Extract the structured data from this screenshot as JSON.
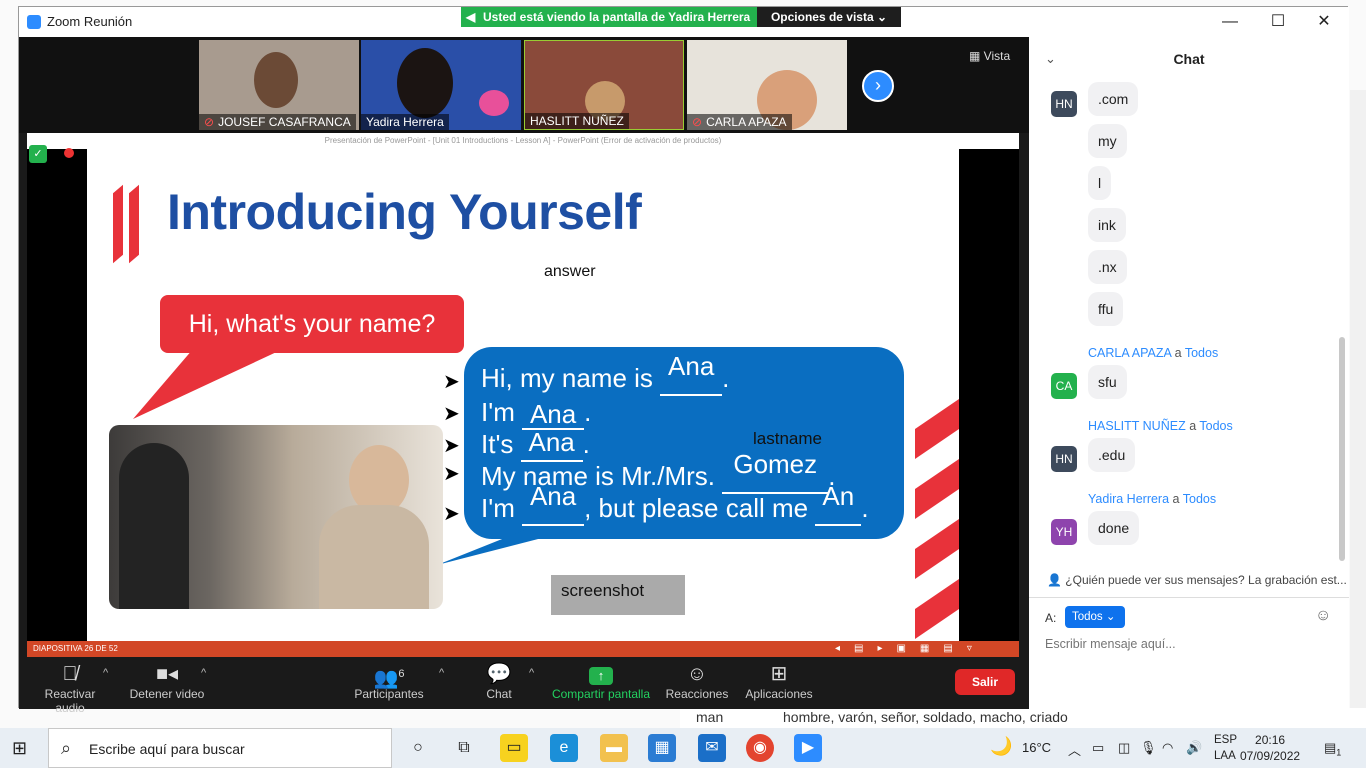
{
  "window": {
    "title": "Zoom Reunión",
    "share_banner": "Usted está viendo la pantalla de Yadira Herrera",
    "view_options": "Opciones de vista",
    "view_btn": "Vista"
  },
  "participants": [
    {
      "name": "JOUSEF CASAFRANCA",
      "muted": true,
      "color": "#a89b8f"
    },
    {
      "name": "Yadira Herrera",
      "muted": false,
      "color": "#2a4fa8"
    },
    {
      "name": "HASLITT NUÑEZ",
      "muted": false,
      "color": "#8a4a3a"
    },
    {
      "name": "CARLA APAZA",
      "muted": true,
      "color": "#e7e3db"
    }
  ],
  "ppt": {
    "window_title": "Presentación de PowerPoint - [Unit 01 Introductions - Lesson A] - PowerPoint (Error de activación de productos)",
    "status": "DIAPOSITIVA 26 DE 52"
  },
  "slide": {
    "title": "Introducing Yourself",
    "answer_label": "answer",
    "question": "Hi, what's your name?",
    "lines": [
      {
        "pre": "Hi, my name is ",
        "fill": "Ana",
        "post": "."
      },
      {
        "pre": "I'm ",
        "fill": "Ana",
        "post": "."
      },
      {
        "pre": "It's ",
        "fill": "Ana",
        "post": "."
      },
      {
        "pre": "My name is Mr./Mrs. ",
        "fill": "Gomez",
        "post": "."
      },
      {
        "pre": "I'm ",
        "fill": "Ana",
        "mid": ", but please call me ",
        "fill2": "An",
        "post": "."
      }
    ],
    "lastname_label": "lastname",
    "screenshot_label": "screenshot"
  },
  "toolbar": {
    "audio": "Reactivar audio",
    "video": "Detener video",
    "participants": "Participantes",
    "participants_count": "6",
    "chat": "Chat",
    "share": "Compartir pantalla",
    "reactions": "Reacciones",
    "apps": "Aplicaciones",
    "leave": "Salir"
  },
  "chat": {
    "title": "Chat",
    "to_word": "a",
    "everyone": "Todos",
    "messages_hn": [
      ".com",
      "my",
      "l",
      "ink",
      ".nx",
      "ffu"
    ],
    "carla": {
      "sender": "CARLA APAZA",
      "initials": "CA",
      "text": "sfu",
      "color": "#23b14d"
    },
    "haslitt": {
      "sender": "HASLITT NUÑEZ",
      "initials": "HN",
      "text": ".edu",
      "color": "#3d4a5c"
    },
    "yadira": {
      "sender": "Yadira Herrera",
      "initials": "YH",
      "text": "done",
      "color": "#8e44ad"
    },
    "hn_initials": "HN",
    "notice": "¿Quién puede ver sus mensajes? La grabación est...",
    "to_label": "A:",
    "to_value": "Todos",
    "input_placeholder": "Escribir mensaje aquí..."
  },
  "background": {
    "word": "man",
    "definition": "hombre, varón, señor, soldado, macho, criado"
  },
  "taskbar": {
    "search_placeholder": "Escribe aquí para buscar",
    "weather": "16°C",
    "lang1": "ESP",
    "lang2": "LAA",
    "time": "20:16",
    "date": "07/09/2022",
    "notif_count": "1"
  }
}
